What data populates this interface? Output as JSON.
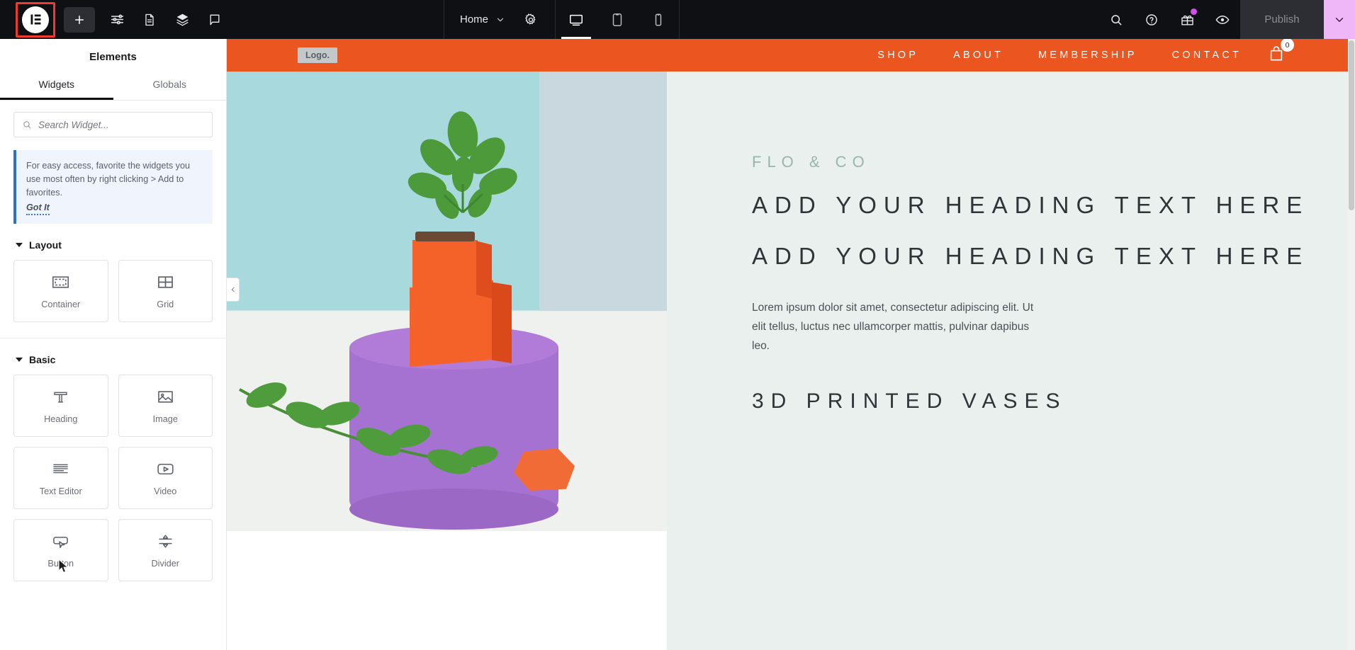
{
  "topbar": {
    "logo_icon": "elementor-logo-icon",
    "add_icon": "plus-icon",
    "settings_icon": "sliders-icon",
    "document_icon": "document-icon",
    "layers_icon": "layers-icon",
    "feedback_icon": "comment-icon",
    "page_label": "Home",
    "page_caret_icon": "chevron-down-icon",
    "gear_icon": "gear-icon",
    "devices": [
      {
        "name": "desktop",
        "icon": "desktop-icon",
        "active": true
      },
      {
        "name": "tablet",
        "icon": "tablet-icon",
        "active": false
      },
      {
        "name": "mobile",
        "icon": "mobile-icon",
        "active": false
      }
    ],
    "search_icon": "search-icon",
    "help_icon": "question-circle-icon",
    "gift_icon": "gift-icon",
    "preview_icon": "eye-icon",
    "publish_label": "Publish",
    "publish_caret_icon": "chevron-down-icon",
    "accent_highlight": "#f2392f",
    "publish_caret_bg": "#efb7f7",
    "notification_color": "#d252e8"
  },
  "sidebar": {
    "title": "Elements",
    "tabs": [
      {
        "label": "Widgets",
        "active": true
      },
      {
        "label": "Globals",
        "active": false
      }
    ],
    "search": {
      "icon": "search-icon",
      "placeholder": "Search Widget...",
      "value": ""
    },
    "notice": {
      "text": "For easy access, favorite the widgets you use most often by right clicking > Add to favorites.",
      "action_label": "Got It",
      "accent": "#2f6fd0",
      "background": "#f0f5fd"
    },
    "sections": [
      {
        "title": "Layout",
        "widgets": [
          {
            "label": "Container",
            "icon": "container-icon"
          },
          {
            "label": "Grid",
            "icon": "grid-icon"
          }
        ]
      },
      {
        "title": "Basic",
        "widgets": [
          {
            "label": "Heading",
            "icon": "heading-icon"
          },
          {
            "label": "Image",
            "icon": "image-icon"
          },
          {
            "label": "Text Editor",
            "icon": "text-editor-icon"
          },
          {
            "label": "Video",
            "icon": "video-icon"
          },
          {
            "label": "Button",
            "icon": "button-icon"
          },
          {
            "label": "Divider",
            "icon": "divider-icon"
          }
        ]
      }
    ],
    "collapse_icon": "chevron-left-icon"
  },
  "preview": {
    "header": {
      "background": "#ea5520",
      "logo_text": "Logo.",
      "nav": [
        {
          "label": "SHOP"
        },
        {
          "label": "ABOUT"
        },
        {
          "label": "MEMBERSHIP"
        },
        {
          "label": "CONTACT"
        }
      ],
      "cart_icon": "shopping-bag-icon",
      "cart_count": "0"
    },
    "hero": {
      "eyebrow": "FLO & CO",
      "heading_1": "ADD YOUR HEADING TEXT HERE",
      "heading_2": "ADD YOUR HEADING TEXT HERE",
      "paragraph": "Lorem ipsum dolor sit amet, consectetur adipiscing elit. Ut elit tellus, luctus nec ullamcorper mattis, pulvinar dapibus leo.",
      "sub_heading": "3D PRINTED VASES",
      "background": "#eaf0ee",
      "eyebrow_color": "#9ab4ac",
      "heading_color": "#2f3437"
    }
  }
}
